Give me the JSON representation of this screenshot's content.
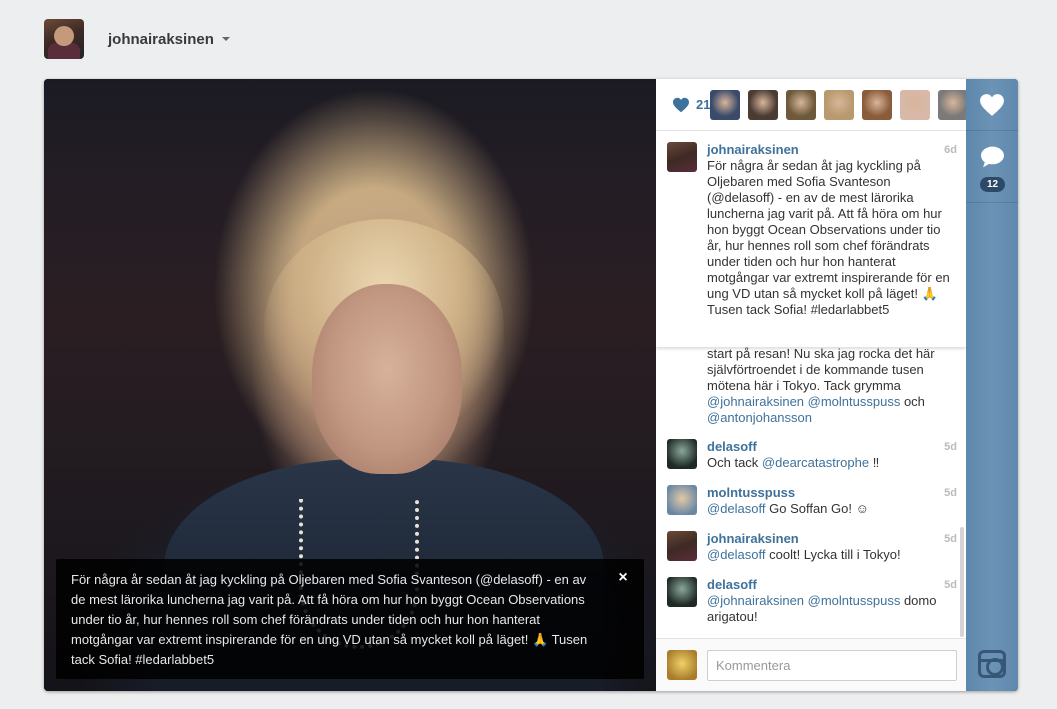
{
  "header": {
    "username": "johnairaksinen"
  },
  "caption": {
    "text": "För några år sedan åt jag kyckling på Oljebaren med Sofia Svanteson (@delasoff) - en av de mest lärorika luncherna jag varit på. Att få höra om hur hon byggt Ocean Observations under tio år, hur hennes roll som chef förändrats under tiden och hur hon hanterat motgångar var extremt inspirerande för en ung VD utan så mycket koll på läget! 🙏 Tusen tack Sofia! #ledarlabbet5",
    "close_label": "×"
  },
  "likes": {
    "count": "21",
    "likers": [
      "#3a4a6a",
      "#4a3b33",
      "#6e5a3a",
      "#b89a6e",
      "#8a5c3c",
      "#d8b8a8",
      "#7a7a7a"
    ]
  },
  "comments": {
    "pinned": {
      "user": "johnairaksinen",
      "time": "6d",
      "text": "För några år sedan åt jag kyckling på Oljebaren med Sofia Svanteson (@delasoff) - en av de mest lärorika luncherna jag varit på. Att få höra om hur hon byggt Ocean Observations under tio år, hur hennes roll som chef förändrats under tiden och hur hon hanterat motgångar var extremt inspirerande för en ung VD utan så mycket koll på läget! 🙏 Tusen tack Sofia! #ledarlabbet5"
    },
    "partial": {
      "text_start": "start på resan! Nu ska jag rocka det här självförtroendet i de kommande tusen mötena här i Tokyo. Tack grymma ",
      "mention1": "@johnairaksinen",
      "mention2": "@molntusspuss",
      "connector": " och ",
      "mention3": "@antonjohansson"
    },
    "items": [
      {
        "user": "delasoff",
        "time": "5d",
        "pre": "Och tack ",
        "mention": "@dearcatastrophe",
        "post": " ‼"
      },
      {
        "user": "molntusspuss",
        "time": "5d",
        "pre": "",
        "mention": "@delasoff",
        "post": " Go Soffan Go! ☺"
      },
      {
        "user": "johnairaksinen",
        "time": "5d",
        "pre": "",
        "mention": "@delasoff",
        "post": " coolt! Lycka till i Tokyo!"
      },
      {
        "user": "delasoff",
        "time": "5d",
        "pre": "",
        "mention": "@johnairaksinen @molntusspuss",
        "post": " domo arigatou!"
      }
    ]
  },
  "comment_box": {
    "placeholder": "Kommentera"
  },
  "rail": {
    "comment_count": "12"
  },
  "colors": {
    "link": "#3f729b",
    "rail": "#6b93b6",
    "badge": "#2c4a68"
  }
}
